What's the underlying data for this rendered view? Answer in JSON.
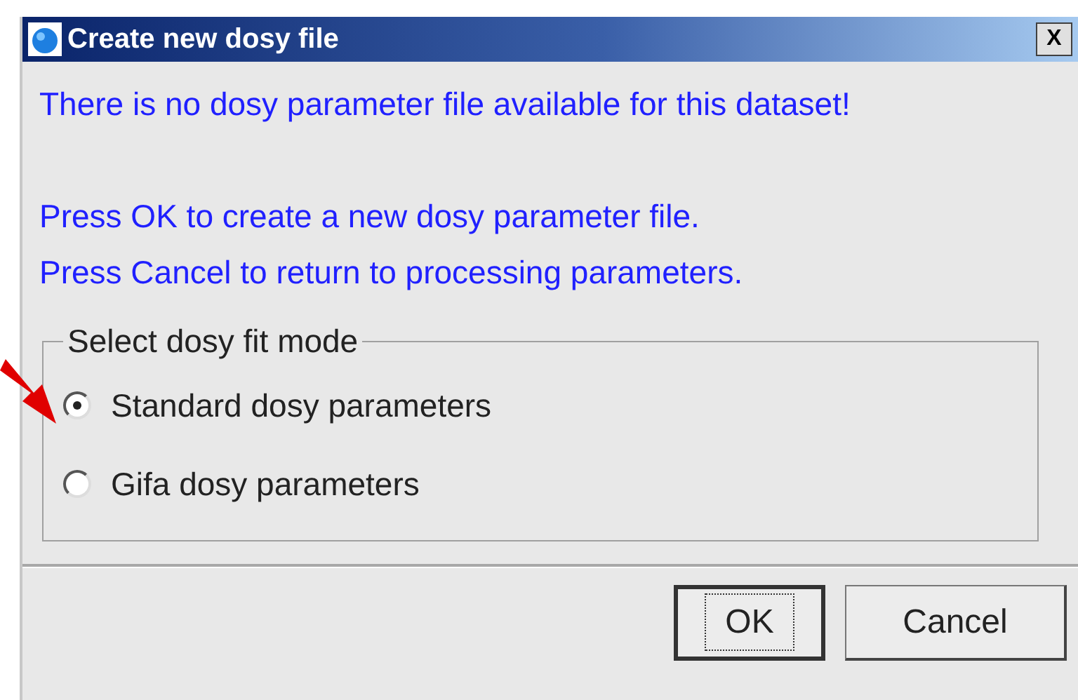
{
  "window": {
    "title": "Create new dosy file",
    "close": "X"
  },
  "message": {
    "warning": "There is no dosy parameter file available for this dataset!",
    "lines": [
      "Press OK to create a new dosy parameter file.",
      "Press Cancel to return to processing parameters."
    ]
  },
  "fit_mode": {
    "legend": "Select dosy fit mode",
    "options": [
      {
        "label": "Standard dosy parameters",
        "selected": true
      },
      {
        "label": "Gifa dosy parameters",
        "selected": false
      }
    ]
  },
  "buttons": [
    {
      "label": "OK",
      "focused": true
    },
    {
      "label": "Cancel",
      "focused": false
    }
  ]
}
